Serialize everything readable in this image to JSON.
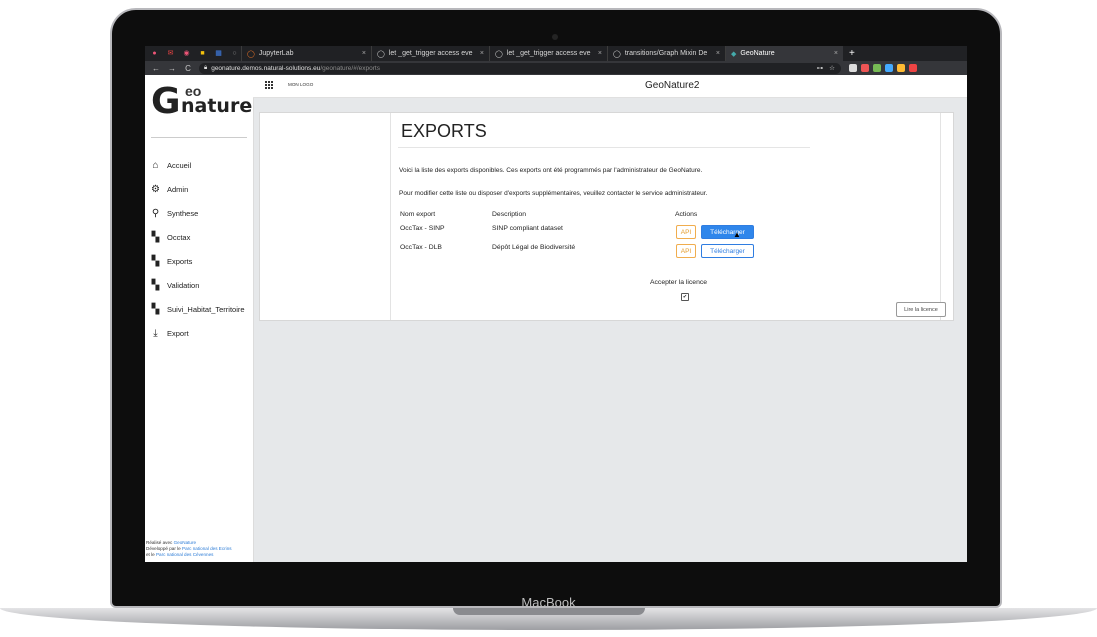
{
  "device": {
    "brand": "MacBook"
  },
  "browser": {
    "tabs": [
      {
        "label": "JupyterLab",
        "close": "×"
      },
      {
        "label": "let _get_trigger access eve",
        "close": "×"
      },
      {
        "label": "let _get_trigger access eve",
        "close": "×"
      },
      {
        "label": "transitions/Graph Mixin De",
        "close": "×"
      },
      {
        "label": "GeoNature",
        "close": "×",
        "active": true
      }
    ],
    "new_tab": "+",
    "nav": {
      "back": "←",
      "forward": "→",
      "reload": "C"
    },
    "url": {
      "host": "geonature.demos.natural-solutions.eu",
      "path": "/geonature/#/exports"
    },
    "key_icon": "⊶",
    "star_icon": "☆"
  },
  "app": {
    "logo": {
      "g": "G",
      "eo": "eo",
      "nature": "nature"
    },
    "topbar": {
      "mon_logo": "MON LOGO",
      "title": "GeoNature2"
    },
    "menu": [
      {
        "label": "Accueil",
        "icon": "home-icon",
        "glyph": "⌂"
      },
      {
        "label": "Admin",
        "icon": "gear-icon",
        "glyph": "⚙"
      },
      {
        "label": "Synthese",
        "icon": "search-icon",
        "glyph": "⚲"
      },
      {
        "label": "Occtax",
        "icon": "puzzle-icon",
        "glyph": "▚"
      },
      {
        "label": "Exports",
        "icon": "puzzle-icon",
        "glyph": "▚"
      },
      {
        "label": "Validation",
        "icon": "puzzle-icon",
        "glyph": "▚"
      },
      {
        "label": "Suivi_Habitat_Territoire",
        "icon": "puzzle-icon",
        "glyph": "▚"
      },
      {
        "label": "Export",
        "icon": "download-icon",
        "glyph": "⤓"
      }
    ],
    "footer": {
      "line1_prefix": "Réalisé avec ",
      "line1_link": "GeoNature",
      "line2_prefix": "Développé par le ",
      "line2_link": "Parc national des Ecrins",
      "line3_prefix": "et le ",
      "line3_link": "Parc national des Cévennes"
    }
  },
  "exports": {
    "title": "EXPORTS",
    "intro": "Voici la liste des exports disponibles. Ces exports ont été programmés par l'administrateur de GeoNature.",
    "contact": "Pour modifier cette liste ou disposer d'exports supplémentaires, veuillez contacter le service administrateur.",
    "headers": {
      "name": "Nom export",
      "description": "Description",
      "actions": "Actions"
    },
    "rows": [
      {
        "name": "OccTax - SINP",
        "description": "SINP compliant dataset",
        "api": "API",
        "download": "Télécharger"
      },
      {
        "name": "OccTax - DLB",
        "description": "Dépôt Légal de Biodiversité",
        "api": "API",
        "download": "Télécharger"
      }
    ],
    "licence_label": "Accepter la licence",
    "licence_checked": "✔",
    "read_licence": "Lire la licence"
  },
  "colors": {
    "primary": "#2f86eb",
    "warning": "#f0ad4e",
    "link": "#2b7bd6"
  }
}
